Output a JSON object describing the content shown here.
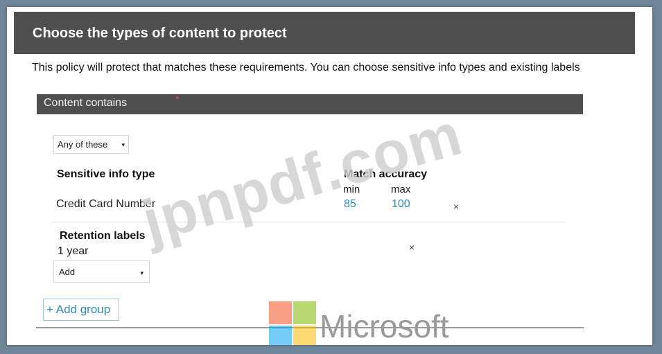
{
  "header": {
    "title": "Choose the types of content to protect"
  },
  "description": "This policy will protect that matches these requirements. You can choose sensitive info types and existing labels",
  "section": {
    "label": "Content contains",
    "required_marker": "*"
  },
  "match_mode": {
    "selected": "Any of these",
    "caret": "▾"
  },
  "sensitive_info": {
    "column_header": "Sensitive info type",
    "accuracy_header": "Match accuracy",
    "min_label": "min",
    "max_label": "max",
    "rows": [
      {
        "name": "Credit Card Number",
        "min": "85",
        "max": "100",
        "remove": "×"
      }
    ]
  },
  "retention": {
    "header": "Retention labels",
    "items": [
      {
        "name": "1 year",
        "remove": "×"
      }
    ],
    "add_dropdown": {
      "label": "Add",
      "caret": "▾"
    }
  },
  "add_group": {
    "icon": "+",
    "label": "Add group"
  },
  "watermark": "jpnpdf.com",
  "brand": {
    "name": "Microsoft",
    "logo_colors": [
      "#f25022",
      "#7fba00",
      "#00a4ef",
      "#ffb900"
    ]
  }
}
